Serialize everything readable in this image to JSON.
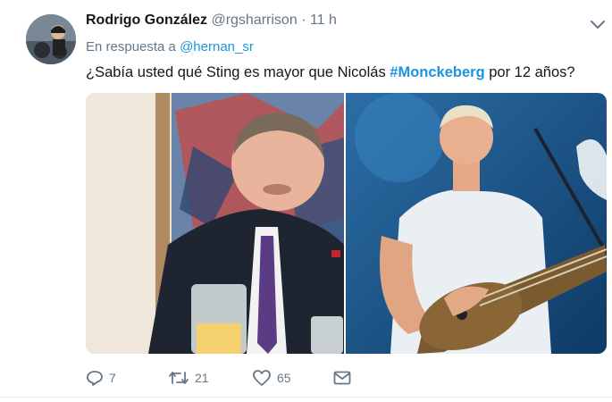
{
  "tweet": {
    "author_name": "Rodrigo González",
    "handle": "@rgsharrison",
    "separator": "·",
    "time": "11 h",
    "reply_prefix": "En respuesta a",
    "reply_to": "@hernan_sr",
    "text_before": "¿Sabía usted qué Sting es mayor que Nicolás ",
    "hashtag": "#Monckeberg",
    "text_after": " por 12 años?"
  },
  "actions": {
    "reply_count": "7",
    "retweet_count": "21",
    "like_count": "65"
  },
  "colors": {
    "link": "#1b95e0",
    "meta": "#657786",
    "text": "#14171a"
  },
  "icons": [
    "avatar",
    "chevron-down-icon",
    "reply-icon",
    "retweet-icon",
    "heart-icon",
    "envelope-icon"
  ]
}
